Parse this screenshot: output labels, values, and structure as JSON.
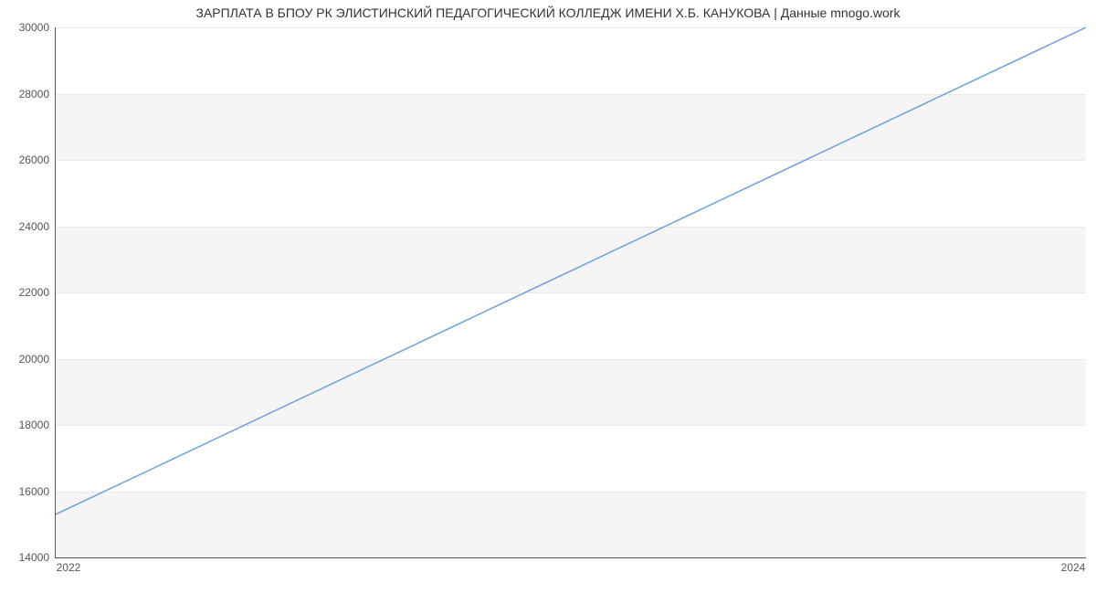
{
  "chart_data": {
    "type": "line",
    "title": "ЗАРПЛАТА В БПОУ РК ЭЛИСТИНСКИЙ ПЕДАГОГИЧЕСКИЙ КОЛЛЕДЖ ИМЕНИ Х.Б. КАНУКОВА | Данные mnogo.work",
    "xlabel": "",
    "ylabel": "",
    "x": [
      2022,
      2024
    ],
    "values": [
      15300,
      30000
    ],
    "xlim": [
      2022,
      2024
    ],
    "ylim": [
      14000,
      30000
    ],
    "xticks": [
      2022,
      2024
    ],
    "yticks": [
      14000,
      16000,
      18000,
      20000,
      22000,
      24000,
      26000,
      28000,
      30000
    ],
    "line_color": "#6f9fe0",
    "band_color": "#f5f5f5",
    "grid": true
  }
}
